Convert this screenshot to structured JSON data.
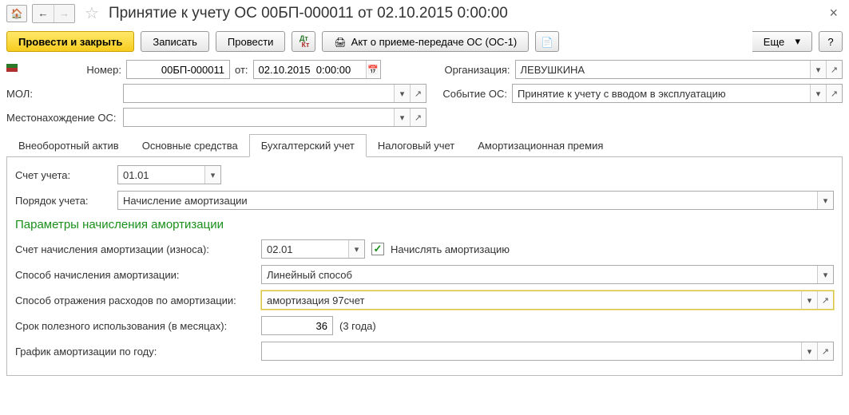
{
  "title": "Принятие к учету ОС 00БП-000011 от 02.10.2015 0:00:00",
  "toolbar": {
    "post_close": "Провести и закрыть",
    "write": "Записать",
    "post": "Провести",
    "print_act": "Акт о приеме-передаче ОС (ОС-1)",
    "more": "Еще",
    "help": "?"
  },
  "header": {
    "number_label": "Номер:",
    "number": "00БП-000011",
    "from_label": "от:",
    "date": "02.10.2015  0:00:00",
    "org_label": "Организация:",
    "org": "ЛЕВУШКИНА",
    "mol_label": "МОЛ:",
    "mol": "",
    "event_label": "Событие ОС:",
    "event": "Принятие к учету с вводом в эксплуатацию",
    "location_label": "Местонахождение ОС:",
    "location": ""
  },
  "tabs": {
    "t1": "Внеоборотный актив",
    "t2": "Основные средства",
    "t3": "Бухгалтерский учет",
    "t4": "Налоговый учет",
    "t5": "Амортизационная премия"
  },
  "bu": {
    "account_label": "Счет учета:",
    "account": "01.01",
    "order_label": "Порядок учета:",
    "order": "Начисление амортизации",
    "section": "Параметры начисления амортизации",
    "dep_account_label": "Счет начисления амортизации (износа):",
    "dep_account": "02.01",
    "charge_label": "Начислять амортизацию",
    "method_label": "Способ начисления амортизации:",
    "method": "Линейный способ",
    "expense_label": "Способ отражения расходов по амортизации:",
    "expense": "амортизация 97счет",
    "life_label": "Срок полезного использования (в месяцах):",
    "life": "36",
    "life_hint": "(3 года)",
    "schedule_label": "График амортизации по году:",
    "schedule": ""
  }
}
